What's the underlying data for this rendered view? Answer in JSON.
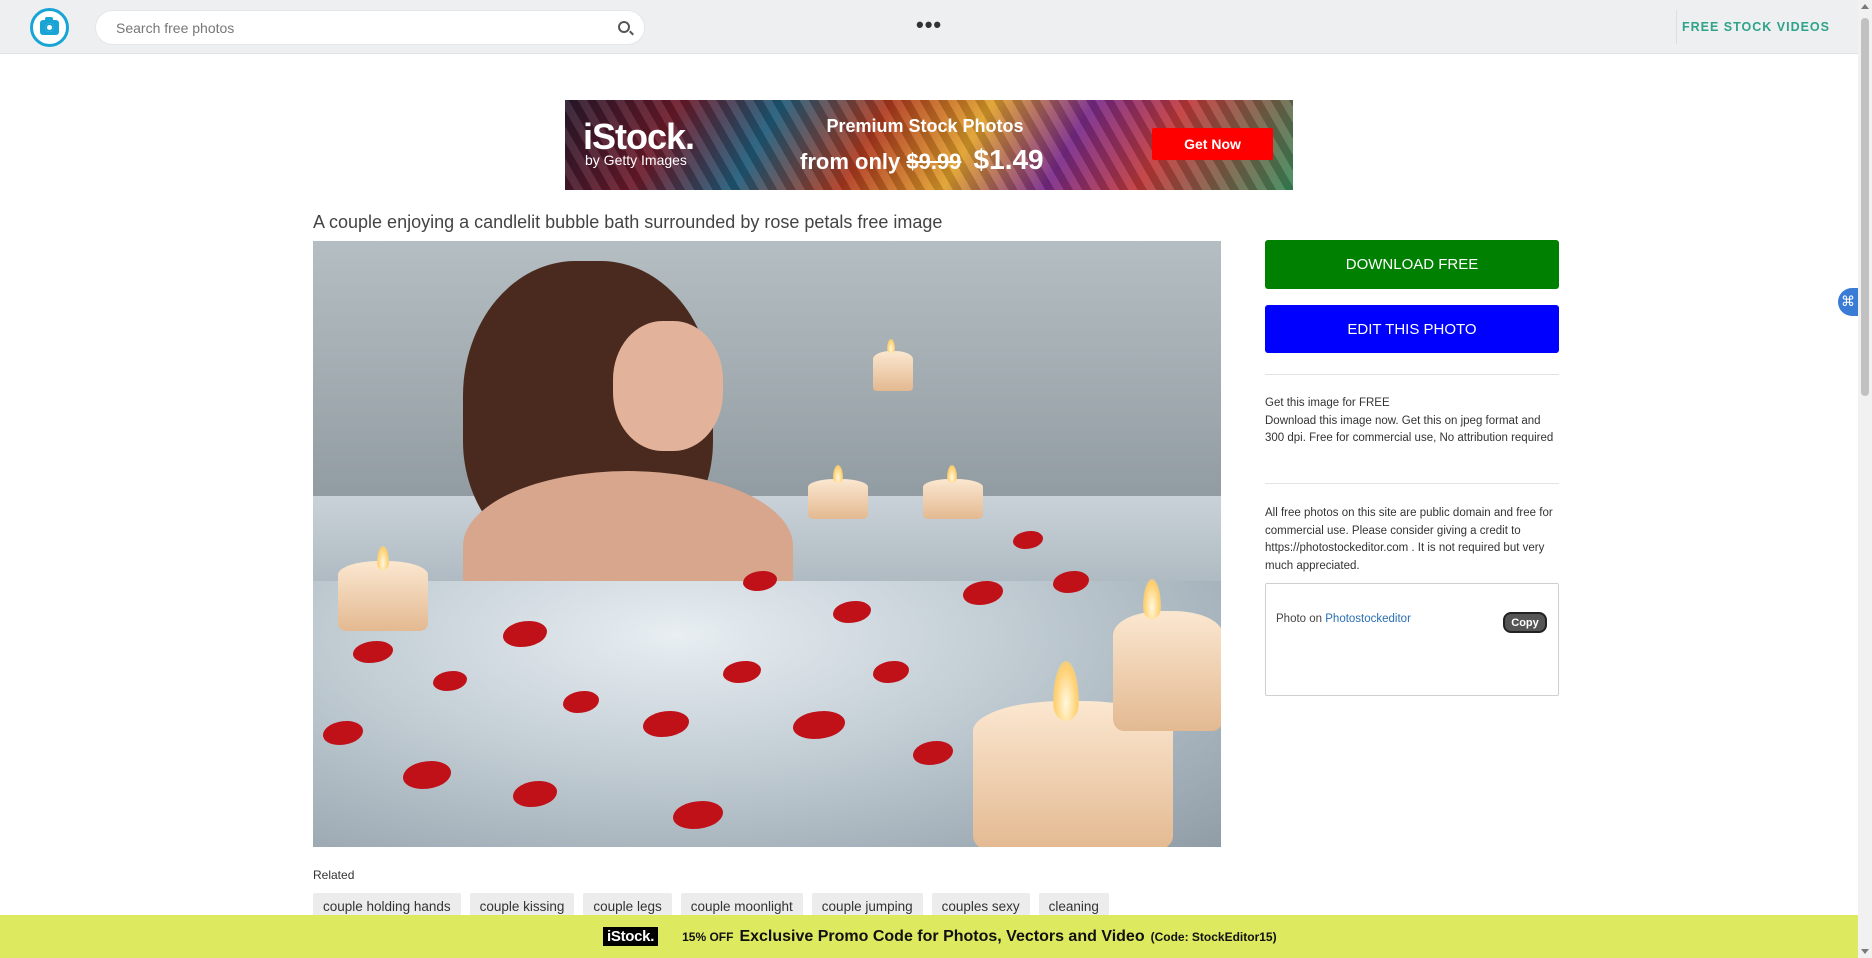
{
  "header": {
    "search_placeholder": "Search free photos",
    "more_menu": "•••",
    "videos_link": "FREE STOCK VIDEOS"
  },
  "ad": {
    "brand": "iStock.",
    "brand_sub": "by Getty Images",
    "headline": "Premium Stock Photos",
    "price_prefix": "from only",
    "old_price": "$9.99",
    "new_price": "$1.49",
    "cta": "Get Now"
  },
  "page": {
    "title": "A couple enjoying a candlelit bubble bath surrounded by rose petals free image"
  },
  "sidebar": {
    "download_label": "DOWNLOAD FREE",
    "edit_label": "EDIT THIS PHOTO",
    "info_heading": "Get this image for FREE",
    "info_body": "Download this image now. Get this on jpeg format and 300 dpi. Free for commercial use, No attribution required",
    "license_text": "All free photos on this site are public domain and free for commercial use. Please consider giving a credit to https://photostockeditor.com . It is not required but very much appreciated.",
    "credit_prefix": "Photo on",
    "credit_link": "Photostockeditor",
    "copy_label": "Copy"
  },
  "related": {
    "label": "Related",
    "tags": [
      "couple holding hands",
      "couple kissing",
      "couple legs",
      "couple moonlight",
      "couple jumping",
      "couples sexy",
      "cleaning"
    ]
  },
  "promo": {
    "logo": "iStock.",
    "discount": "15% OFF",
    "message": "Exclusive Promo Code for Photos, Vectors and Video",
    "code": "(Code: StockEditor15)"
  },
  "colors": {
    "download_button": "#008000",
    "edit_button": "#0000ff",
    "promo_bar": "#dde95e",
    "accent": "#19a4d6",
    "videos_link": "#2fa38a"
  }
}
